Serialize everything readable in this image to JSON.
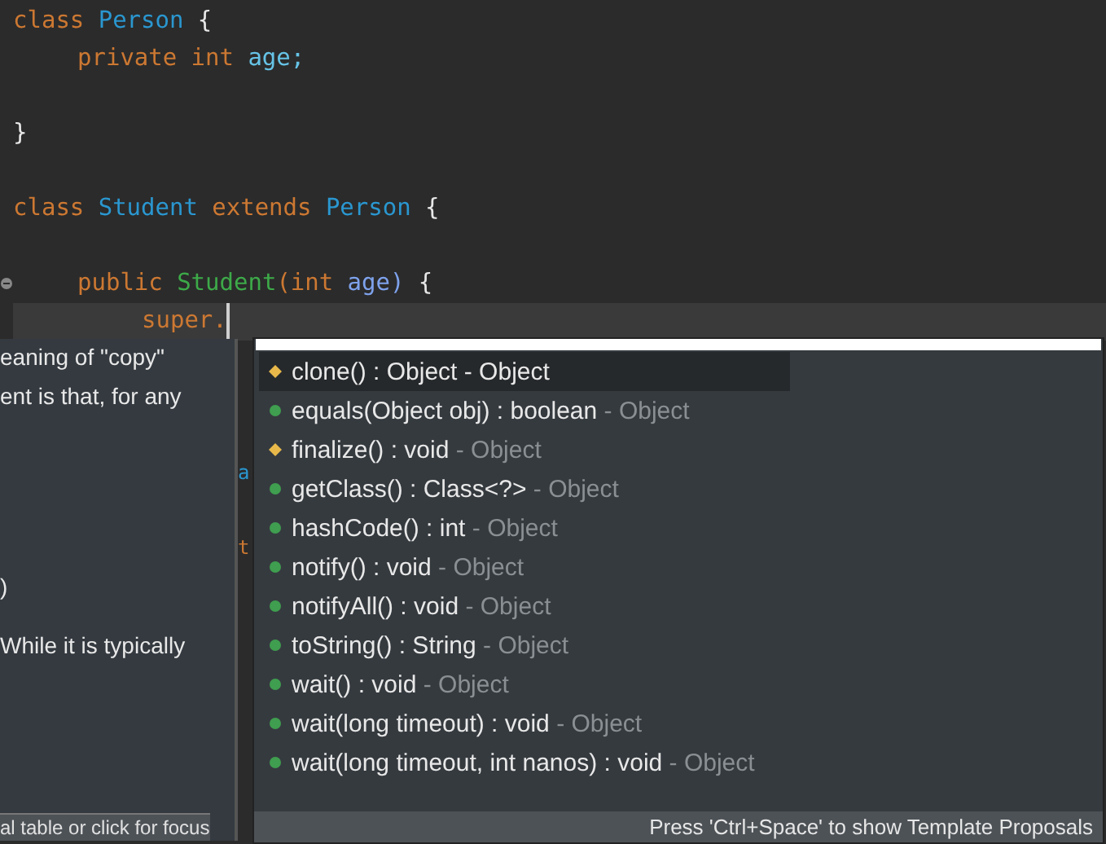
{
  "editor": {
    "lines": [
      {
        "kind": "code",
        "tokens": [
          {
            "text": "class",
            "kind": "keyword"
          },
          {
            "text": "Person",
            "kind": "type"
          },
          {
            "text": "{",
            "kind": "plain"
          }
        ],
        "children": [
          {
            "kind": "code",
            "tokens": [
              {
                "text": "private",
                "kind": "keyword"
              },
              {
                "text": "int",
                "kind": "keyword"
              },
              {
                "text": "age;",
                "kind": "field"
              }
            ]
          },
          {
            "kind": "blank"
          }
        ]
      },
      {
        "kind": "code",
        "tokens": [
          {
            "text": "}",
            "kind": "plain"
          }
        ]
      },
      {
        "kind": "blank"
      },
      {
        "kind": "code",
        "tokens": [
          {
            "text": "class",
            "kind": "keyword"
          },
          {
            "text": "Student",
            "kind": "type"
          },
          {
            "text": "extends",
            "kind": "keyword"
          },
          {
            "text": "Person",
            "kind": "type"
          },
          {
            "text": "{",
            "kind": "plain"
          }
        ],
        "children": [
          {
            "kind": "blank"
          },
          {
            "kind": "code",
            "folded": false,
            "tokens": [
              {
                "text": "public",
                "kind": "keyword"
              },
              {
                "text": "Student",
                "kind": "method"
              },
              {
                "text": "(int",
                "kind": "keyword",
                "glued": true
              },
              {
                "text": "age)",
                "kind": "param"
              },
              {
                "text": "{",
                "kind": "plain"
              }
            ],
            "children": [
              {
                "kind": "code",
                "current": true,
                "tokens": [
                  {
                    "text": "super.",
                    "kind": "keyword"
                  }
                ]
              }
            ]
          }
        ]
      }
    ],
    "gap_fragments": [
      {
        "text": "a",
        "kind": "type"
      },
      {
        "text": "t",
        "kind": "keyword"
      }
    ]
  },
  "javadoc_popup": {
    "lines": [
      "eaning of \"copy\"",
      "ent is that, for any",
      ")",
      "While it is typically"
    ],
    "footer": "al table or click for focus"
  },
  "proposals": {
    "items": [
      {
        "label": "clone() : Object",
        "origin": "- Object",
        "kind": "protected",
        "selected": true
      },
      {
        "label": "equals(Object obj) : boolean",
        "origin": "- Object",
        "kind": "public",
        "selected": false
      },
      {
        "label": "finalize() : void",
        "origin": "- Object",
        "kind": "protected",
        "selected": false
      },
      {
        "label": "getClass() : Class<?>",
        "origin": "- Object",
        "kind": "public",
        "selected": false
      },
      {
        "label": "hashCode() : int",
        "origin": "- Object",
        "kind": "public",
        "selected": false
      },
      {
        "label": "notify() : void",
        "origin": "- Object",
        "kind": "public",
        "selected": false
      },
      {
        "label": "notifyAll() : void",
        "origin": "- Object",
        "kind": "public",
        "selected": false
      },
      {
        "label": "toString() : String",
        "origin": "- Object",
        "kind": "public",
        "selected": false
      },
      {
        "label": "wait() : void",
        "origin": "- Object",
        "kind": "public",
        "selected": false
      },
      {
        "label": "wait(long timeout) : void",
        "origin": "- Object",
        "kind": "public",
        "selected": false
      },
      {
        "label": "wait(long timeout, int nanos) : void",
        "origin": "- Object",
        "kind": "public",
        "selected": false
      }
    ],
    "footer": "Press 'Ctrl+Space' to show Template Proposals"
  }
}
